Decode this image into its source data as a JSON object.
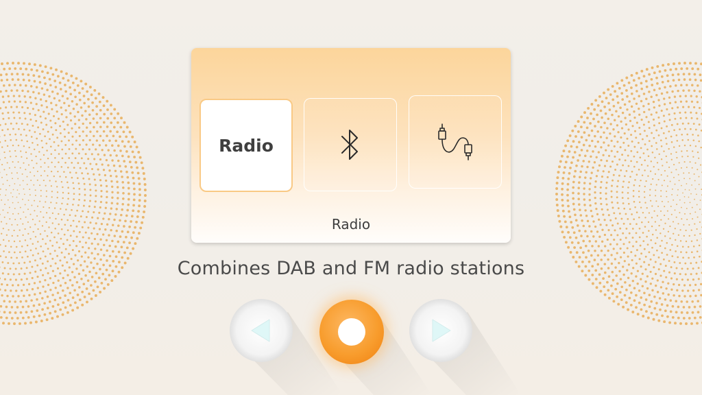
{
  "source_selector": {
    "tiles": [
      {
        "label": "Radio",
        "icon": "radio-text",
        "selected": true
      },
      {
        "label": "",
        "icon": "bluetooth-icon",
        "selected": false
      },
      {
        "label": "",
        "icon": "aux-cable-icon",
        "selected": false
      }
    ],
    "current_source": "Radio"
  },
  "description": "Combines DAB and FM radio stations",
  "controls": {
    "previous_icon": "triangle-left-icon",
    "center_icon": "dot-icon",
    "next_icon": "triangle-right-icon"
  },
  "colors": {
    "accent": "#f89d2e",
    "speaker_dots": "#e8ad58",
    "panel_top": "#fcd59b",
    "arrow_fill": "#dff7f7"
  }
}
